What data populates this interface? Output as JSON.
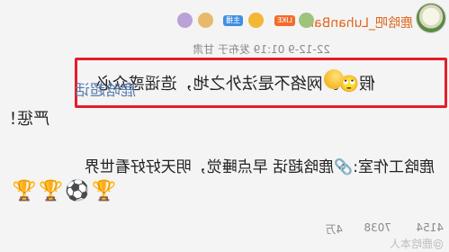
{
  "post": {
    "username": "鹿晗吧_LuhanBar",
    "badge_like": "LIKE",
    "badge_host": "主播",
    "meta": "22-12-9 01:19 发布于 甘肃",
    "main_text": "假🙄。网络不是法外之地，造谣惑众必",
    "overlap_text": "鹿晗超话",
    "continuation": "严惩！",
    "second_line": "鹿晗工作室:🔗鹿晗超话 早点睡觉，明天好好看世界",
    "trophies": "🏆⚽🏆🏆",
    "stats": {
      "likes": "4154",
      "comments": "7038",
      "shares": "4万"
    },
    "watermark": "@鹿晗本人"
  },
  "colors": {
    "highlight": "#e31e2c",
    "link": "#5b7fb0",
    "username": "#e0651a"
  }
}
